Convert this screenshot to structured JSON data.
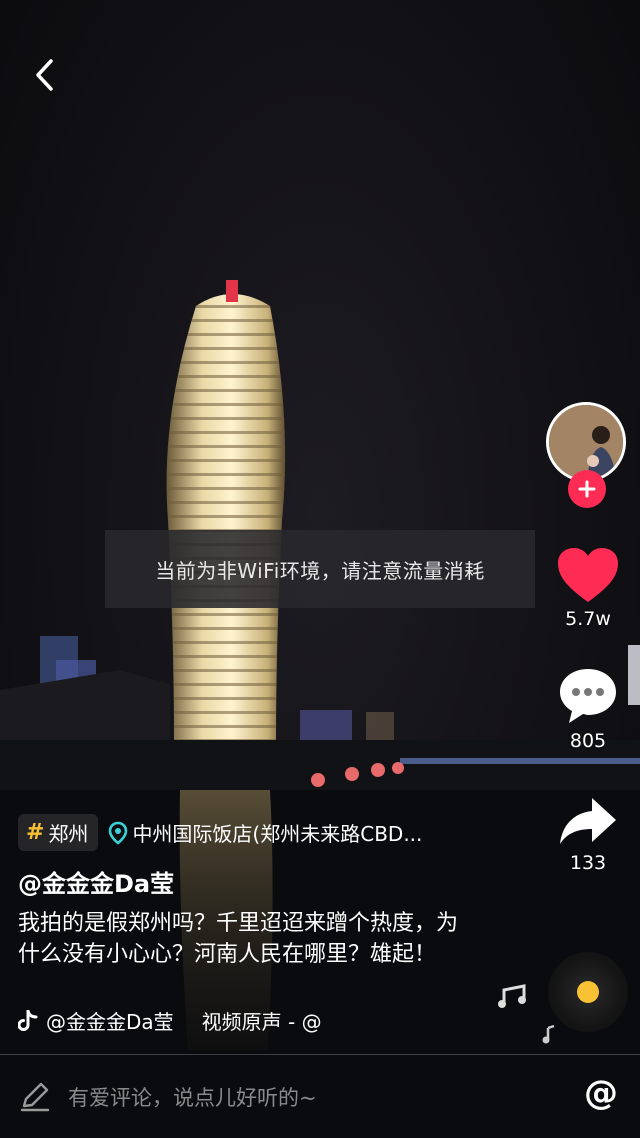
{
  "toast": {
    "text": "当前为非WiFi环境，请注意流量消耗"
  },
  "actions": {
    "likes": "5.7w",
    "comments": "805",
    "shares": "133"
  },
  "hashtag": {
    "symbol": "#",
    "label": "郑州"
  },
  "location": {
    "label": "中州国际饭店(郑州未来路CBD..."
  },
  "author": {
    "handle": "@金金金Da莹"
  },
  "caption": "我拍的是假郑州吗？千里迢迢来蹭个热度，为什么没有小心心？河南人民在哪里？雄起！",
  "music": {
    "author": "@金金金Da莹",
    "title": "视频原声 - @"
  },
  "comment": {
    "placeholder": "有爱评论，说点儿好听的~",
    "at_symbol": "@"
  },
  "colors": {
    "accent": "#fe2c55",
    "hashtag": "#f8c234",
    "location": "#3ad4d8"
  },
  "icons": [
    "back-icon",
    "heart-icon",
    "comment-icon",
    "share-icon",
    "plus-icon",
    "location-pin-icon",
    "tiktok-note-icon",
    "music-notes-icon",
    "pencil-icon"
  ]
}
